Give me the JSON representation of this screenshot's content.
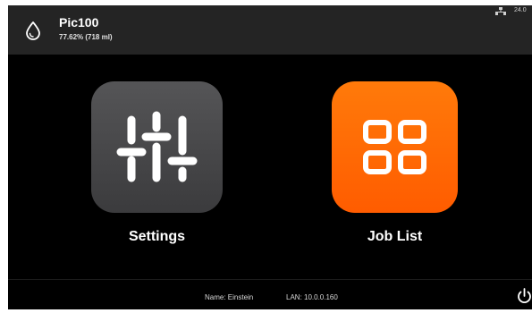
{
  "header": {
    "status_icon": "water-drop-icon",
    "title": "Pic100",
    "subtitle": "77.62% (718 ml)",
    "network_icon": "network-icon",
    "clock": "24.0"
  },
  "tiles": [
    {
      "label": "Settings",
      "icon": "sliders-icon",
      "color": "#4a4a4c"
    },
    {
      "label": "Job List",
      "icon": "grid-icon",
      "color": "#ff6a00"
    }
  ],
  "footer": {
    "name": "Name: Einstein",
    "lan": "LAN: 10.0.0.160",
    "power_icon": "power-icon"
  },
  "colors": {
    "background": "#000000",
    "header": "#242424",
    "accent": "#ff6a00"
  }
}
